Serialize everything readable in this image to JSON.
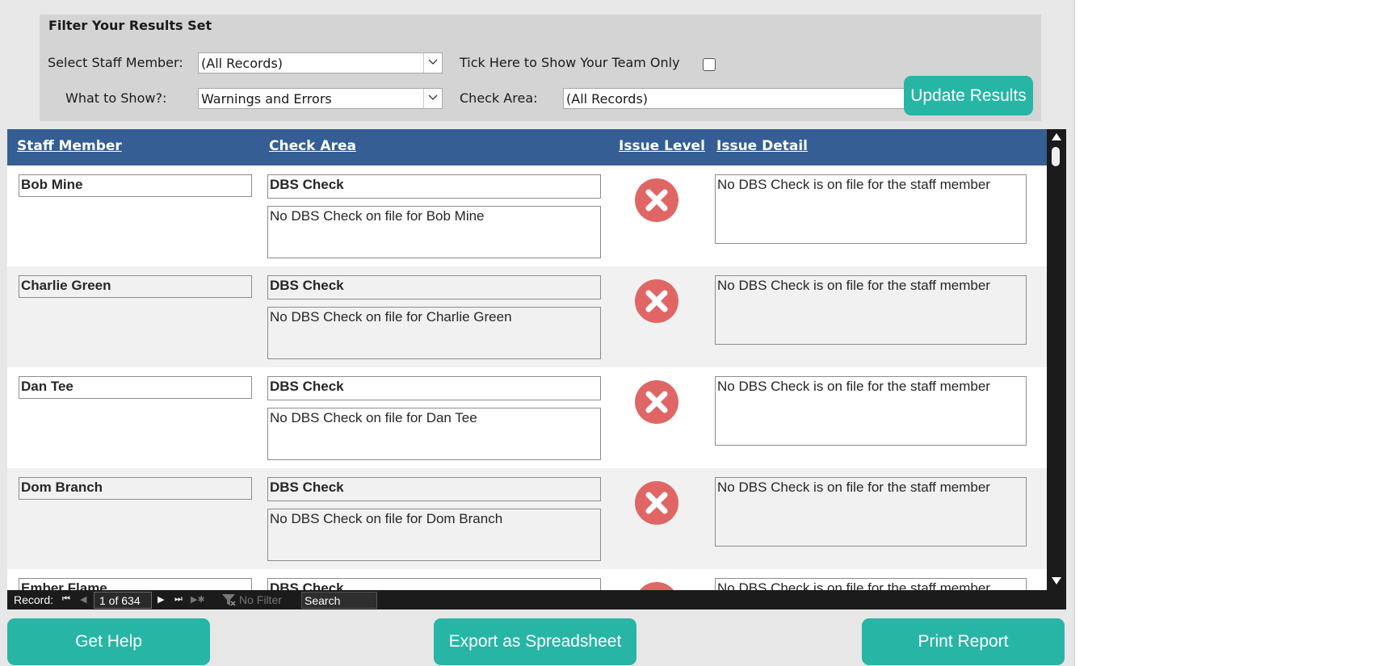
{
  "filter": {
    "title": "Filter Your Results Set",
    "staff_label": "Select Staff Member:",
    "staff_value": "(All Records)",
    "team_label": "Tick Here to Show Your Team Only",
    "show_label": "What to Show?:",
    "show_value": "Warnings and Errors",
    "area_label": "Check Area:",
    "area_value": "(All Records)",
    "update_label": "Update Results"
  },
  "columns": {
    "staff": "Staff Member",
    "area": "Check Area",
    "level": "Issue Level",
    "detail": "Issue Detail"
  },
  "rows": [
    {
      "name": "Bob Mine",
      "area": "DBS Check",
      "note": "No DBS Check on file for Bob Mine",
      "level": "error",
      "detail": "No DBS Check is on file for the staff member"
    },
    {
      "name": "Charlie Green",
      "area": "DBS Check",
      "note": "No DBS Check on file for Charlie Green",
      "level": "error",
      "detail": "No DBS Check is on file for the staff member"
    },
    {
      "name": "Dan Tee",
      "area": "DBS Check",
      "note": "No DBS Check on file for Dan Tee",
      "level": "error",
      "detail": "No DBS Check is on file for the staff member"
    },
    {
      "name": "Dom Branch",
      "area": "DBS Check",
      "note": "No DBS Check on file for Dom Branch",
      "level": "error",
      "detail": "No DBS Check is on file for the staff member"
    },
    {
      "name": "Ember Flame",
      "area": "DBS Check",
      "note": "",
      "level": "error",
      "detail": "No DBS Check is on file for the staff member"
    }
  ],
  "nav": {
    "record_label": "Record:",
    "position": "1 of 634",
    "filter_label": "No Filter",
    "search_label": "Search"
  },
  "footer": {
    "help_label": "Get Help",
    "export_label": "Export as Spreadsheet",
    "print_label": "Print Report"
  },
  "colors": {
    "accent": "#27b5a5",
    "header": "#345e94",
    "error": "#e06666"
  },
  "icons": {
    "error": "error-x-icon"
  }
}
